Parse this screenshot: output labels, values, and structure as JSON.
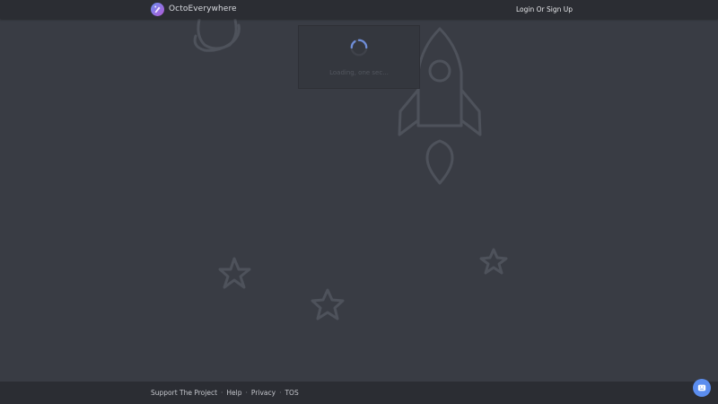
{
  "header": {
    "brand_name": "OctoEverywhere",
    "login_label": "Login Or Sign Up"
  },
  "loading": {
    "text": "Loading, one sec..."
  },
  "footer": {
    "links": [
      {
        "label": "Support The Project"
      },
      {
        "label": "Help"
      },
      {
        "label": "Privacy"
      },
      {
        "label": "TOS"
      }
    ],
    "separator": "·"
  },
  "colors": {
    "background": "#393c44",
    "navbar": "#2b2d33",
    "art_stroke": "#4e525b",
    "chat_button": "#5b8def",
    "logo_gradient_start": "#6a8cf0",
    "logo_gradient_end": "#b35bd6"
  },
  "icons": {
    "brand_logo": "octoeverywhere-logo-icon",
    "spinner": "loading-spinner-icon",
    "chat": "chat-icon"
  }
}
